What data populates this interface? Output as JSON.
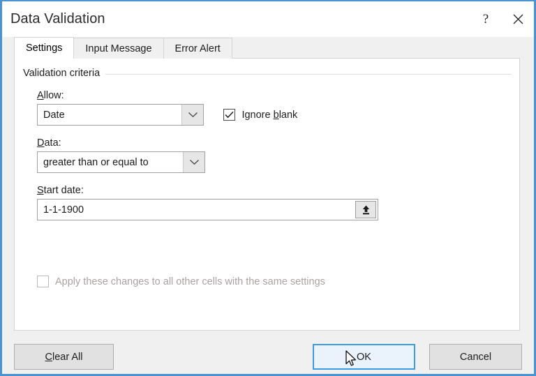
{
  "window": {
    "title": "Data Validation",
    "help_icon": "question-mark-icon",
    "close_icon": "close-icon",
    "border_color": "#4a93d0"
  },
  "tabs": [
    {
      "label": "Settings",
      "active": true
    },
    {
      "label": "Input Message",
      "active": false
    },
    {
      "label": "Error Alert",
      "active": false
    }
  ],
  "settings": {
    "group_title": "Validation criteria",
    "allow": {
      "label_prefix": "",
      "label_accel": "A",
      "label_suffix": "llow:",
      "value": "Date",
      "arrow_icon": "chevron-down-icon"
    },
    "ignore_blank": {
      "label_prefix": "Ignore ",
      "label_accel": "b",
      "label_suffix": "lank",
      "checked": true,
      "check_icon": "checkmark-icon"
    },
    "data": {
      "label_accel": "D",
      "label_suffix": "ata:",
      "value": "greater than or equal to",
      "arrow_icon": "chevron-down-icon"
    },
    "start_date": {
      "label_accel": "S",
      "label_suffix": "tart date:",
      "value": "1-1-1900",
      "placeholder": "",
      "range_icon": "collapse-dialog-arrow-icon"
    },
    "apply_all": {
      "label": "Apply these changes to all other cells with the same settings",
      "checked": false,
      "disabled": true
    }
  },
  "footer": {
    "clear_all": {
      "accel": "C",
      "suffix": "lear All"
    },
    "ok": "OK",
    "cancel": "Cancel"
  },
  "cursor": {
    "type": "arrow-pointer"
  }
}
